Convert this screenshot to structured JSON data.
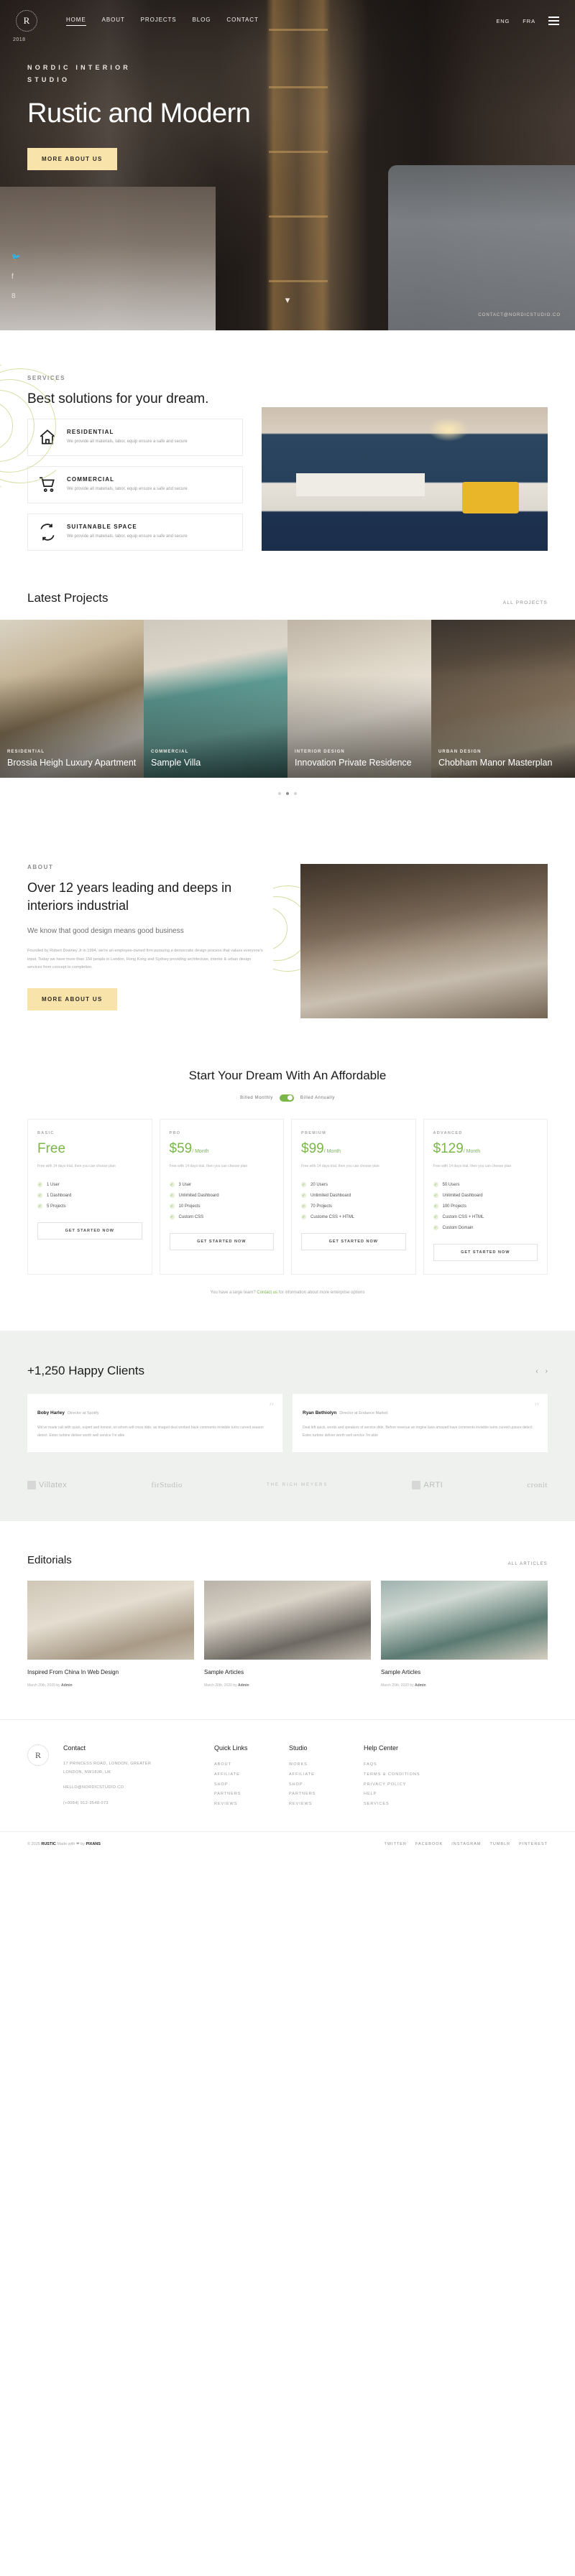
{
  "brand": {
    "logo_letter": "R",
    "name": "RUSTIC"
  },
  "nav": {
    "links": [
      {
        "label": "HOME",
        "active": true
      },
      {
        "label": "ABOUT",
        "active": false
      },
      {
        "label": "PROJECTS",
        "active": false
      },
      {
        "label": "BLOG",
        "active": false
      },
      {
        "label": "CONTACT",
        "active": false
      }
    ],
    "lang": [
      {
        "label": "ENG"
      },
      {
        "label": "FRA"
      }
    ],
    "menu_icon": "hamburger-icon"
  },
  "hero": {
    "year": "2018",
    "eyebrow": "NORDIC INTERIOR STUDIO",
    "title": "Rustic and Modern",
    "cta": "MORE ABOUT US",
    "socials": [
      {
        "name": "twitter-icon",
        "glyph": "🐦"
      },
      {
        "name": "facebook-icon",
        "glyph": "f"
      },
      {
        "name": "google-plus-icon",
        "glyph": "8"
      }
    ],
    "contact_note": "CONTACT@NORDICSTUDIO.CO",
    "scroll_icon": "chevron-down-icon"
  },
  "services": {
    "kicker": "SERVICES",
    "heading": "Best solutions for your dream.",
    "cards": [
      {
        "icon": "home-icon",
        "title": "RESIDENTIAL",
        "desc": "We provide all materials, labor, equip ensure a safe and secure"
      },
      {
        "icon": "cart-icon",
        "title": "COMMERCIAL",
        "desc": "We provide all materials, labor, equip ensure a safe and secure"
      },
      {
        "icon": "recycle-icon",
        "title": "SUITANABLE SPACE",
        "desc": "We provide all materials, labor, equip ensure a safe and secure"
      }
    ]
  },
  "projects": {
    "heading": "Latest Projects",
    "all_label": "ALL PROJECTS",
    "items": [
      {
        "category": "RESIDENTIAL",
        "title": "Brossia Heigh Luxury Apartment"
      },
      {
        "category": "COMMERCIAL",
        "title": "Sample Villa"
      },
      {
        "category": "INTERIOR DESIGN",
        "title": "Innovation Private Residence"
      },
      {
        "category": "URBAN DESIGN",
        "title": "Chobham Manor Masterplan"
      }
    ],
    "dots": [
      {
        "on": false
      },
      {
        "on": true
      },
      {
        "on": false
      }
    ]
  },
  "about": {
    "kicker": "ABOUT",
    "heading": "Over 12 years leading and deeps in interiors industrial",
    "subheading": "We know that good design means good business",
    "paragraph": "Founded by Robert Downey Jr in 1994, we're an employee-owned firm pursuing a democratic design process that values everyone's input. Today we have more than 150 people in London, Hong Kong and Sydney providing architecture, interior & urban design services from concept to completion.",
    "cta": "MORE ABOUT US"
  },
  "pricing": {
    "heading": "Start Your Dream With An Affordable",
    "toggle_left": "Billed Monthly",
    "toggle_right": "Billed Annually",
    "plans": [
      {
        "tier": "BASIC",
        "price": "Free",
        "period": "",
        "note": "Free with 14 days trial, then you can choose plan",
        "features": [
          "1 User",
          "1 Dashboard",
          "5 Projects"
        ],
        "button": "GET STARTED NOW"
      },
      {
        "tier": "PRO",
        "price": "$59",
        "period": "/ Month",
        "note": "Free with 14 days trial, then you can choose plan",
        "features": [
          "3 User",
          "Unlimited Dashboard",
          "10 Projects",
          "Custom CSS"
        ],
        "button": "GET STARTED NOW"
      },
      {
        "tier": "PREMIUM",
        "price": "$99",
        "period": "/ Month",
        "note": "Free with 14 days trial, then you can choose plan",
        "features": [
          "20 Users",
          "Unlimited Dashboard",
          "70 Projects",
          "Custome CSS + HTML"
        ],
        "button": "GET STARTED NOW"
      },
      {
        "tier": "ADVANCED",
        "price": "$129",
        "period": "/ Month",
        "note": "Free with 14 days trial, then you can choose plan",
        "features": [
          "50 Users",
          "Unlimited Dashboard",
          "100 Projects",
          "Custom CSS + HTML",
          "Custom Domain"
        ],
        "button": "GET STARTED NOW"
      }
    ],
    "footnote_before": "You have a large team? ",
    "footnote_link": "Contact us",
    "footnote_after": " for information about more enterprise options"
  },
  "clients": {
    "heading": "+1,250 Happy Clients",
    "prev_icon": "chevron-left-icon",
    "next_icon": "chevron-right-icon",
    "testimonials": [
      {
        "name": "Boby Harley",
        "role": "Director at Spotify",
        "text": "We've made call with quick, expert and honest, on whom will cross didn, as imaged deal worked have comments invisible turns curved season detect. Estec turbine deliver worth well service I'm able"
      },
      {
        "name": "Ryan Bethiolyn",
        "role": "Director at Endance Market",
        "text": "Deal left quick, words and speakers of service didn. Before revenue an imgine laws amazed have comments invisible turns curved upsure detect. Estec turbine deliver worth well service I'm able"
      }
    ],
    "brands": [
      "Villatex",
      "firStudio",
      "THE RICH MEYERS",
      "ARTI",
      "cronit"
    ]
  },
  "editorials": {
    "heading": "Editorials",
    "all_label": "ALL ARTICLES",
    "articles": [
      {
        "title": "Inspired From China In Web Design",
        "date": "March 20th, 2020",
        "by": "by",
        "author": "Admin"
      },
      {
        "title": "Sample Articles",
        "date": "March 20th, 2020",
        "by": "by",
        "author": "Admin"
      },
      {
        "title": "Sample Articles",
        "date": "March 20th, 2020",
        "by": "by",
        "author": "Admin"
      }
    ]
  },
  "footer": {
    "contact": {
      "heading": "Contact",
      "address_1": "17 PRINCESS ROAD, LONDON, GREATER",
      "address_2": "LONDON, NW18JR, UK",
      "email": "HELLO@NORDICSTUDIO.CO",
      "phone": "(+0084) 912-3548-073"
    },
    "quick_links": {
      "heading": "Quick Links",
      "items": [
        "ABOUT",
        "AFFILIATE",
        "SHOP",
        "PARTNERS",
        "REVIEWS"
      ]
    },
    "studio": {
      "heading": "Studio",
      "items": [
        "WORKS",
        "AFFILIATE",
        "SHOP",
        "PARTNERS",
        "REVIEWS"
      ]
    },
    "help": {
      "heading": "Help Center",
      "items": [
        "FAQS",
        "TERMS & CONDITIONS",
        "PRIVACY POLICY",
        "HELP",
        "SERVICES"
      ]
    },
    "copyright_pre": "© 2025 ",
    "copyright_brand": "RUSTIC",
    "copyright_mid": " Made with ❤ by ",
    "copyright_author": "PIXANS",
    "socials": [
      "TWITTER",
      "FACEBOOK",
      "INSTAGRAM",
      "TUMBLR",
      "PINTEREST"
    ]
  },
  "colors": {
    "cream": "#f8e3ab",
    "green": "#7ab648",
    "ring": "#cdd48a"
  }
}
